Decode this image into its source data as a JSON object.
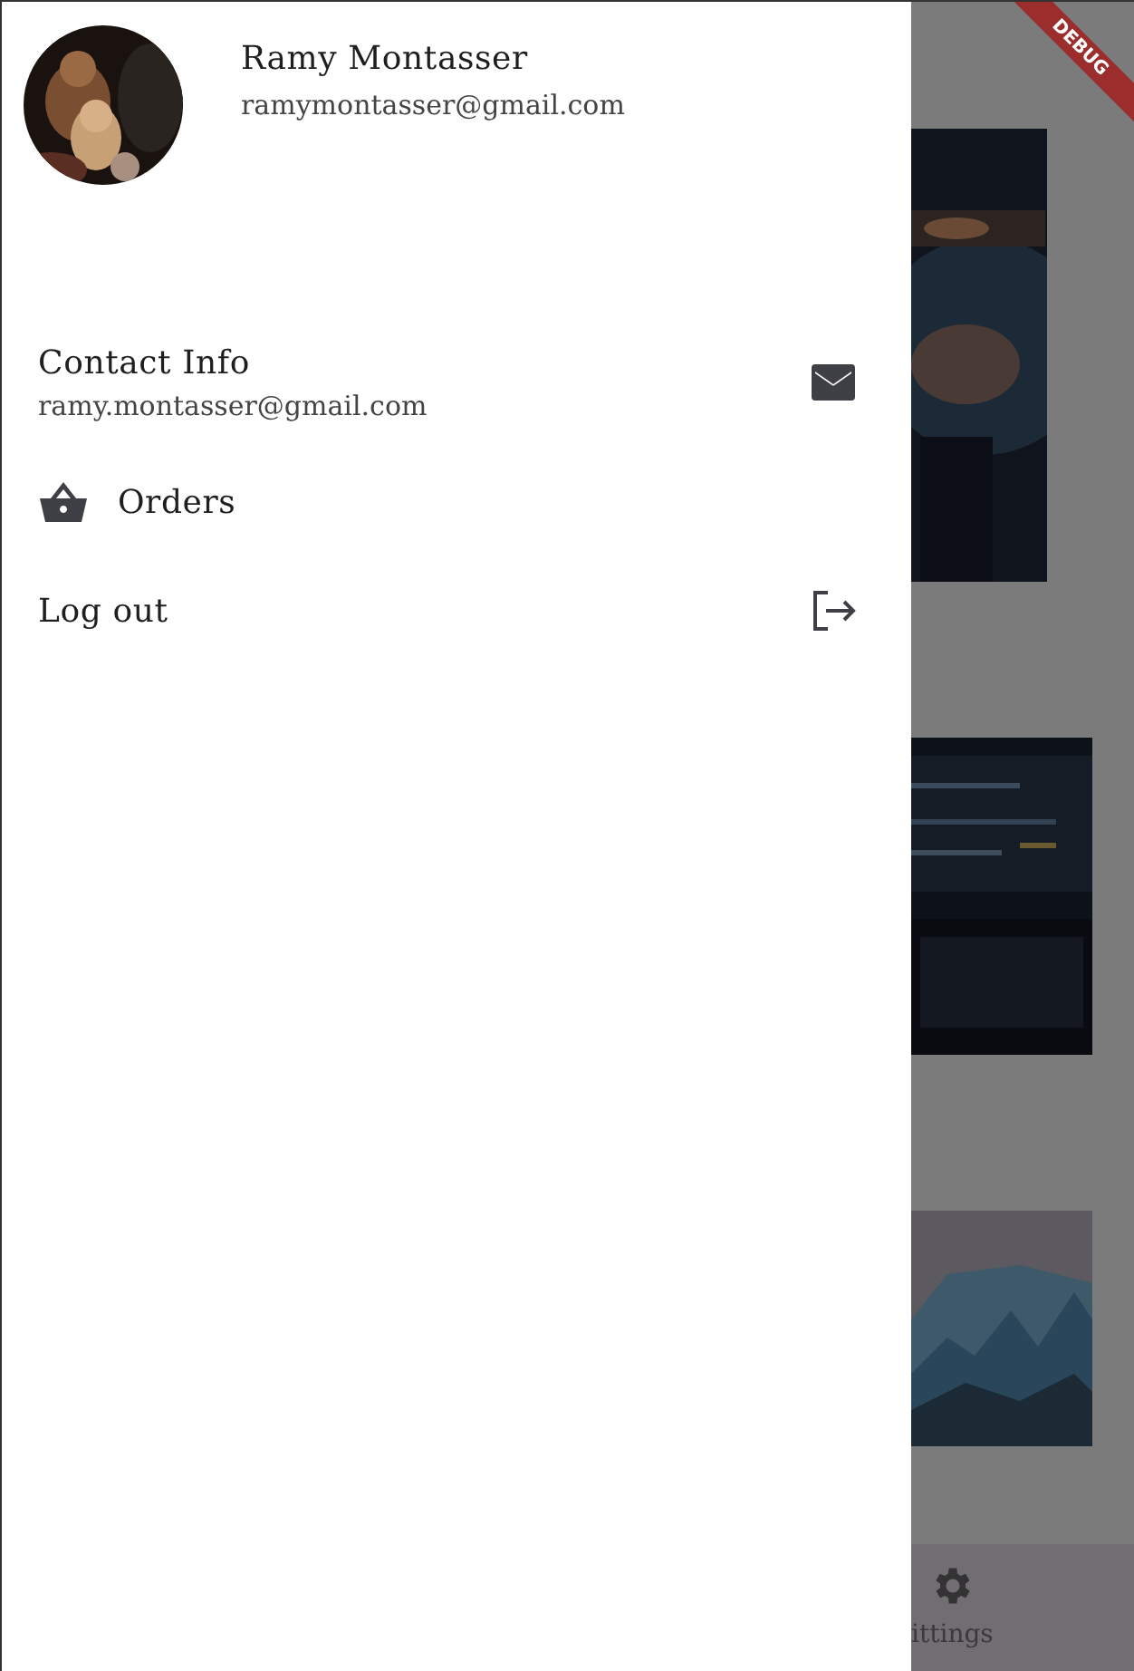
{
  "drawer": {
    "header": {
      "name": "Ramy Montasser",
      "email": "ramymontasser@gmail.com"
    },
    "menu": [
      {
        "kind": "contact",
        "label": "Contact Info",
        "detail": "ramy.montasser@gmail.com"
      },
      {
        "kind": "orders",
        "label": "Orders"
      },
      {
        "kind": "logout",
        "label": "Log out"
      }
    ]
  },
  "bottom_nav": {
    "items": [
      {
        "label": "ittings"
      }
    ]
  },
  "debug_banner": "DEBUG"
}
